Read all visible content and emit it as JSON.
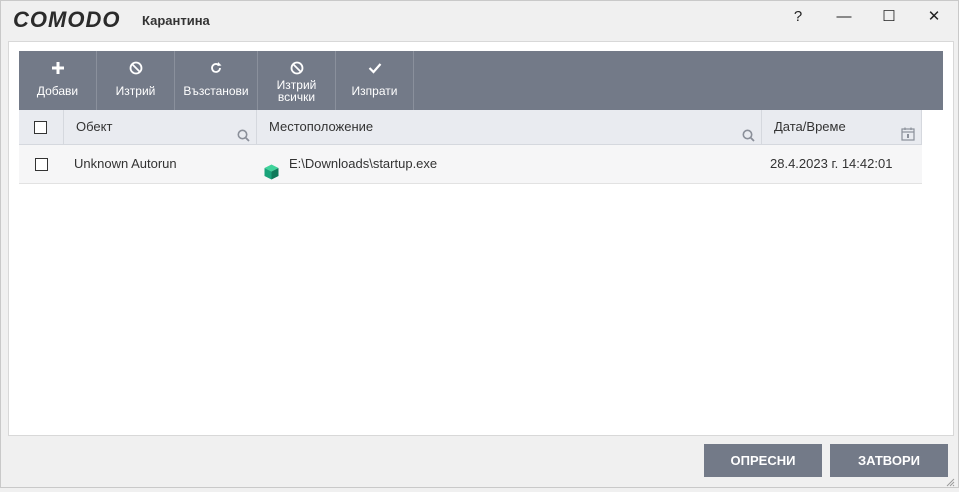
{
  "app": {
    "logo": "COMODO",
    "title": "Карантина"
  },
  "window_controls": {
    "help": "?",
    "minimize": "—",
    "maximize": "☐",
    "close": "✕"
  },
  "toolbar": {
    "buttons": [
      {
        "label": "Добави",
        "icon": "plus-icon"
      },
      {
        "label": "Изтрий",
        "icon": "block-icon"
      },
      {
        "label": "Възстанови",
        "icon": "restore-icon"
      },
      {
        "label_line1": "Изтрий",
        "label_line2": "всички",
        "icon": "block-icon"
      },
      {
        "label": "Изпрати",
        "icon": "check-icon"
      }
    ]
  },
  "table": {
    "columns": {
      "object": "Обект",
      "location": "Местоположение",
      "datetime": "Дата/Време"
    },
    "rows": [
      {
        "object": "Unknown Autorun",
        "location": "E:\\Downloads\\startup.exe",
        "datetime": "28.4.2023 г. 14:42:01"
      }
    ]
  },
  "footer": {
    "refresh": "ОПРЕСНИ",
    "close": "ЗАТВОРИ"
  },
  "colors": {
    "toolbar": "#737a88",
    "header": "#e9ebf0",
    "accent_icon": "#1aa37a"
  }
}
